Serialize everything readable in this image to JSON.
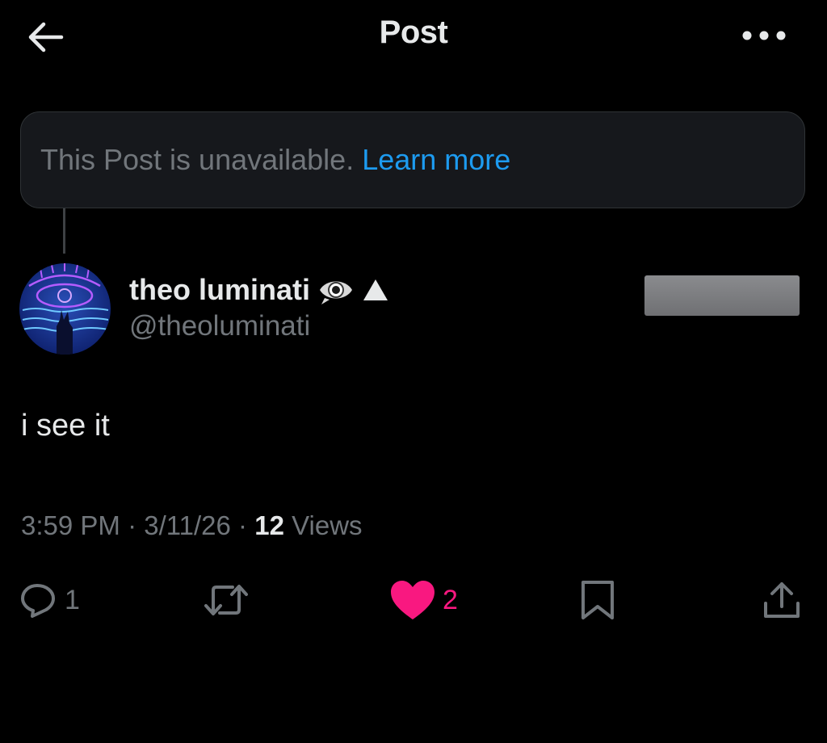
{
  "header": {
    "title": "Post",
    "back_icon": "arrow-left-icon",
    "more_icon": "more-horizontal-icon"
  },
  "notice": {
    "text": "This Post is unavailable.",
    "link": "Learn more",
    "link_color": "#1d9bf0"
  },
  "author": {
    "display_name": "theo luminati",
    "handle": "@theoluminati",
    "badges": [
      "eye-icon",
      "triangle-icon"
    ]
  },
  "post": {
    "text": "i see it"
  },
  "meta": {
    "time": "3:59 PM",
    "separator": " · ",
    "date": "3/11/26",
    "views_count": "12",
    "views_label": " Views"
  },
  "actions": {
    "reply": {
      "icon": "reply-icon",
      "count": "1"
    },
    "repost": {
      "icon": "repost-icon",
      "count": ""
    },
    "like": {
      "icon": "heart-icon",
      "count": "2",
      "active": true,
      "color": "#f91880"
    },
    "bookmark": {
      "icon": "bookmark-icon"
    },
    "share": {
      "icon": "share-icon"
    }
  }
}
